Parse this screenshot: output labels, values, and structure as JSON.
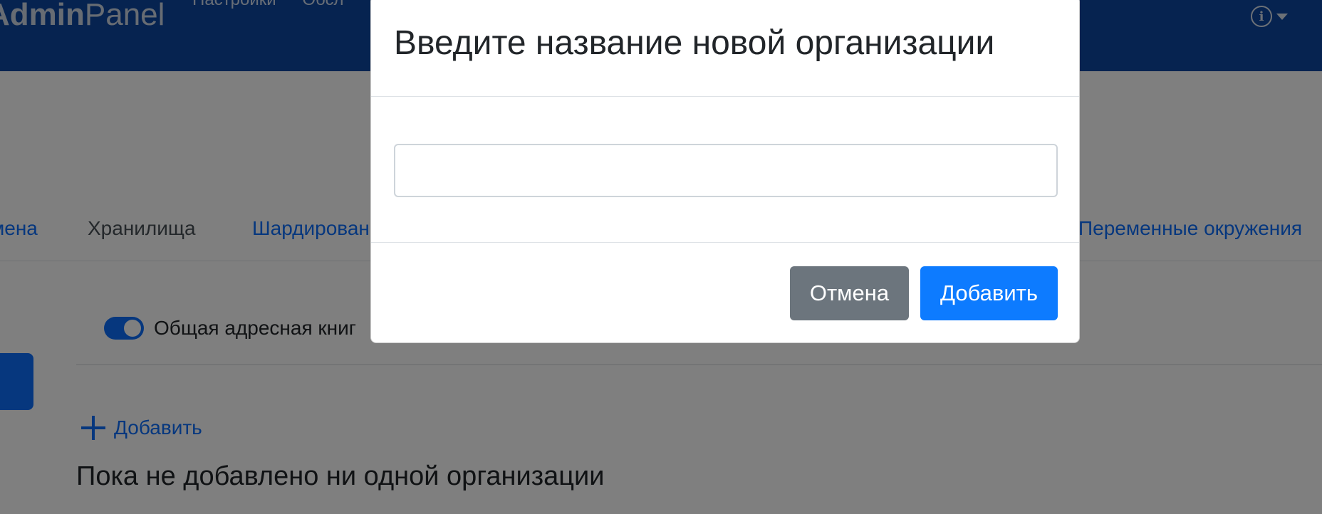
{
  "app": {
    "brand_part1": "Admin",
    "brand_part2": "Panel",
    "nav_items": [
      "Настройки",
      "Обсл"
    ]
  },
  "tabs": [
    {
      "label": "мена"
    },
    {
      "label": "Хранилища",
      "active": true
    },
    {
      "label": "Шардирован"
    },
    {
      "label": "Переменные окружения"
    }
  ],
  "toggle": {
    "label": "Общая адресная книг",
    "checked": true
  },
  "actions": {
    "add_label": "Добавить"
  },
  "empty_state": "Пока не добавлено ни одной организации",
  "modal": {
    "title": "Введите название новой организации",
    "input_value": "",
    "input_placeholder": "",
    "cancel_label": "Отмена",
    "submit_label": "Добавить"
  },
  "colors": {
    "navbar": "#0d47a1",
    "primary": "#0d6efd",
    "secondary": "#6c757d"
  }
}
